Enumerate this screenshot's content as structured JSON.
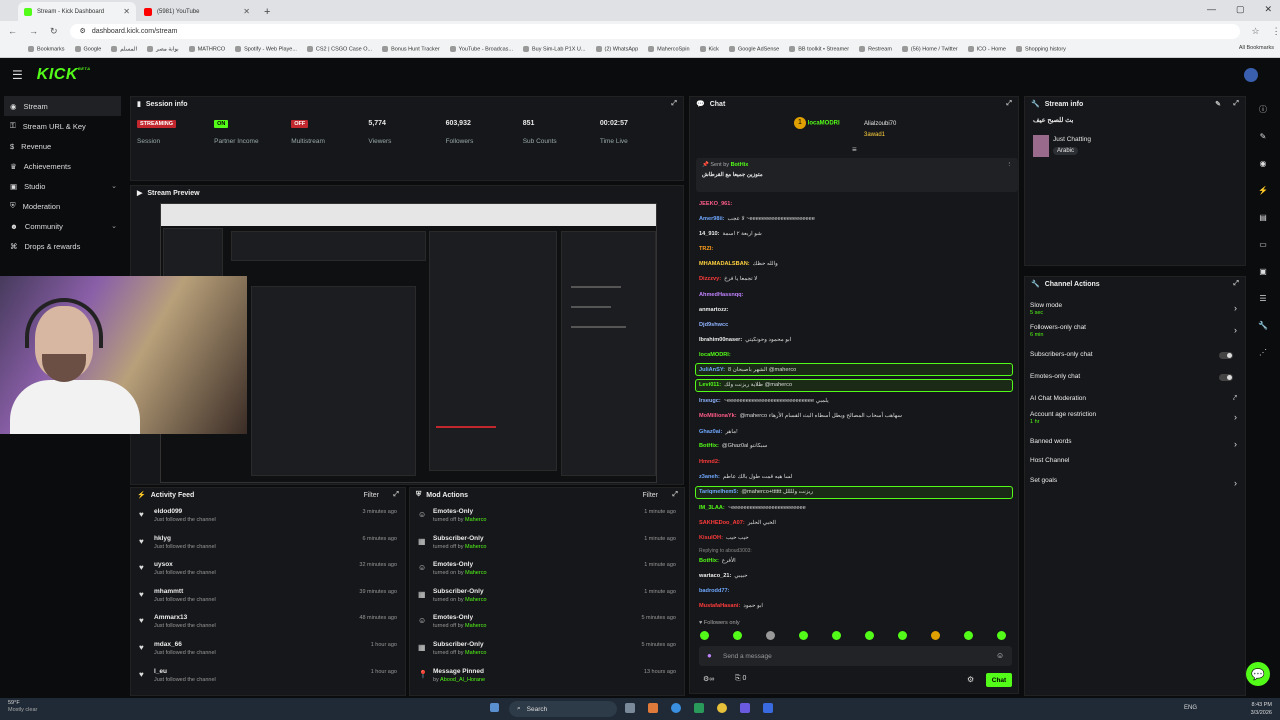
{
  "browser": {
    "tabs": [
      {
        "title": "Stream - Kick Dashboard",
        "fav_color": "#53fc18"
      },
      {
        "title": "(5981) YouTube",
        "fav_color": "#ff0000"
      }
    ],
    "url": "dashboard.kick.com/stream",
    "bookmarks": [
      "Bookmarks",
      "Google",
      "المسلم",
      "بوابة مصر",
      "MATHRCO",
      "Spotify - Web Playe...",
      "CS2 | CSGO Case O...",
      "Bonus Hunt Tracker",
      "YouTube - Broadcas...",
      "Buy Sim-Lab P1X U...",
      "(2) WhatsApp",
      "MahercoSpin",
      "Kick",
      "Google AdSense",
      "BB toolkit • Streamer",
      "Restream",
      "(56) Home / Twitter",
      "ICO - Home",
      "Shopping history"
    ],
    "all_bookmarks": "All Bookmarks"
  },
  "header": {
    "logo": "KICK",
    "beta": "BETA"
  },
  "sidebar": {
    "items": [
      {
        "label": "Stream",
        "icon": "stream-icon"
      },
      {
        "label": "Stream URL & Key",
        "icon": "key-icon"
      },
      {
        "label": "Revenue",
        "icon": "revenue-icon"
      },
      {
        "label": "Achievements",
        "icon": "trophy-icon"
      },
      {
        "label": "Studio",
        "icon": "studio-icon"
      },
      {
        "label": "Moderation",
        "icon": "shield-icon"
      },
      {
        "label": "Community",
        "icon": "community-icon"
      },
      {
        "label": "Drops & rewards",
        "icon": "gift-icon"
      }
    ]
  },
  "session": {
    "title": "Session info",
    "stats": [
      {
        "value": "STREAMING",
        "label": "Session",
        "badge": "red"
      },
      {
        "value": "ON",
        "label": "Partner Income",
        "badge": "green"
      },
      {
        "value": "OFF",
        "label": "Multistream",
        "badge": "red"
      },
      {
        "value": "5,774",
        "label": "Viewers"
      },
      {
        "value": "603,932",
        "label": "Followers"
      },
      {
        "value": "851",
        "label": "Sub Counts"
      },
      {
        "value": "00:02:57",
        "label": "Time Live"
      }
    ]
  },
  "preview": {
    "title": "Stream Preview"
  },
  "activity": {
    "title": "Activity Feed",
    "filter": "Filter",
    "items": [
      {
        "name": "eldod099",
        "sub": "Just followed the channel",
        "time": "3 minutes ago"
      },
      {
        "name": "hklyg",
        "sub": "Just followed the channel",
        "time": "6 minutes ago"
      },
      {
        "name": "uysox",
        "sub": "Just followed the channel",
        "time": "32 minutes ago"
      },
      {
        "name": "mhammtt",
        "sub": "Just followed the channel",
        "time": "39 minutes ago"
      },
      {
        "name": "Ammarx13",
        "sub": "Just followed the channel",
        "time": "48 minutes ago"
      },
      {
        "name": "mdax_66",
        "sub": "Just followed the channel",
        "time": "1 hour ago"
      },
      {
        "name": "l_eu",
        "sub": "Just followed the channel",
        "time": "1 hour ago"
      }
    ]
  },
  "mod": {
    "title": "Mod Actions",
    "filter": "Filter",
    "items": [
      {
        "name": "Emotes-Only",
        "pre": "turned off by",
        "by": "Maherco",
        "time": "1 minute ago",
        "icon": "smile-icon"
      },
      {
        "name": "Subscriber-Only",
        "pre": "turned off by",
        "by": "Maherco",
        "time": "1 minute ago",
        "icon": "gift-icon"
      },
      {
        "name": "Emotes-Only",
        "pre": "turned on by",
        "by": "Maherco",
        "time": "1 minute ago",
        "icon": "smile-icon"
      },
      {
        "name": "Subscriber-Only",
        "pre": "turned on by",
        "by": "Maherco",
        "time": "1 minute ago",
        "icon": "gift-icon"
      },
      {
        "name": "Emotes-Only",
        "pre": "turned off by",
        "by": "Maherco",
        "time": "5 minutes ago",
        "icon": "smile-icon"
      },
      {
        "name": "Subscriber-Only",
        "pre": "turned off by",
        "by": "Maherco",
        "time": "5 minutes ago",
        "icon": "gift-icon"
      },
      {
        "name": "Message Pinned",
        "pre": "by",
        "by": "Abood_Al_Horane",
        "time": "13 hours ago",
        "icon": "pin-icon"
      }
    ]
  },
  "chat": {
    "title": "Chat",
    "top": [
      {
        "name": "locaMODRI",
        "val": "1"
      },
      {
        "name": "Alialzoubi70",
        "val": "1"
      },
      {
        "name": "3awad1",
        "val": "1"
      }
    ],
    "pinned_by": "Sent by",
    "pinned_user": "BotHix",
    "pinned_text": "متوزين جميعا مع القرطاش",
    "messages": [
      {
        "u": "JEEKO_961:",
        "t": "",
        "c": "#ff5c8a"
      },
      {
        "u": "Amer98ii:",
        "t": "لا عجب ~eeeeeeeeeeeeeeeeeeeee",
        "c": "#6fa8ff"
      },
      {
        "u": "14_910:",
        "t": "شو اربعة ٢ اسمة",
        "c": "#eeeeee"
      },
      {
        "u": "TRZI:",
        "t": "",
        "c": "#ff9f1a"
      },
      {
        "u": "MHAMADALSBAN:",
        "t": "والله حظك",
        "c": "#ffd23f"
      },
      {
        "u": "Dizzzvy:",
        "t": "لا تجمعا يا فرخ",
        "c": "#ff3b3b"
      },
      {
        "u": "AhmedHassnqq:",
        "t": "",
        "c": "#c183ff"
      },
      {
        "u": "anmartozz:",
        "t": "",
        "c": "#eeeeee"
      },
      {
        "u": "Djd9shwcc",
        "t": "",
        "c": "#8fb3ff"
      },
      {
        "u": "Ibrahim00naser:",
        "t": "ابو محمود وحونكيتي",
        "c": "#eeeeee"
      },
      {
        "u": "locaMODRI:",
        "t": "",
        "c": "#53fc18"
      },
      {
        "u": "JuliAnSY:",
        "t": "الشهر باصبحان 8 @maherco",
        "c": "#6fa8ff"
      },
      {
        "u": "Levi011:",
        "t": "ظلاية ريزنت ولك @maherco",
        "c": "#53fc18"
      },
      {
        "u": "Irseugc:",
        "t": "~eeeeeeeeeeeeeeeeeeeeeeeeeeee يلمبي",
        "c": "#8fb3ff"
      },
      {
        "u": "MoMillionaYk:",
        "t": "@maherco سهاهب أسحاب المصالح ويطل أسطاه البث القسام الأرهاء",
        "c": "#ff5c8a"
      },
      {
        "u": "Ghaz0ai:",
        "t": "ماهر!",
        "c": "#6fa8ff"
      },
      {
        "u": "BotHix:",
        "t": "@Ghaz0al سبكانتو",
        "c": "#53fc18"
      },
      {
        "u": "Hmnd2:",
        "t": "",
        "c": "#ff3b3b"
      },
      {
        "u": "z3aneh:",
        "t": "لسا هيه قمت طول بالك عاطم",
        "c": "#6fa8ff"
      },
      {
        "u": "Tariqmelhem5:",
        "t": "@maherco+tttttt ريزنت وللللل",
        "c": "#6fa8ff"
      },
      {
        "u": "IM_3LAA:",
        "t": "~eeeeeeeeeeeeeeeeeeeeeeee",
        "c": "#53fc18"
      },
      {
        "u": "SAKHEDoo_A07:",
        "t": "الخبي الحلبر",
        "c": "#ff3b3b"
      },
      {
        "u": "KisulOH:",
        "t": "حيب حيب",
        "c": "#ff3b3b"
      },
      {
        "u": "BotHix:",
        "t": "الأفرع",
        "c": "#53fc18"
      },
      {
        "u": "wartaco_21:",
        "t": "حبيبي",
        "c": "#eeeeee"
      },
      {
        "u": "badrodd77:",
        "t": "",
        "c": "#6fa8ff"
      },
      {
        "u": "MustafaHasani:",
        "t": "ابو حمود",
        "c": "#ff3b3b"
      }
    ],
    "reply": "Replying to aboud3003:",
    "followers_only": "Followers only",
    "placeholder": "Send a message",
    "chat_button": "Chat",
    "points": "0"
  },
  "stream_info": {
    "title": "Stream info",
    "stream_title": "بث للصبح عيف",
    "category": "Just Chatting",
    "tag": "Arabic"
  },
  "channel_actions": {
    "title": "Channel Actions",
    "items": [
      {
        "label": "Slow mode",
        "sub": "5 sec",
        "kind": "arrow"
      },
      {
        "label": "Followers-only chat",
        "sub": "6 min",
        "kind": "arrow"
      },
      {
        "label": "Subscribers-only chat",
        "sub": "",
        "kind": "toggle"
      },
      {
        "label": "Emotes-only chat",
        "sub": "",
        "kind": "toggle"
      },
      {
        "label": "AI Chat Moderation",
        "sub": "",
        "kind": "ext"
      },
      {
        "label": "Account age restriction",
        "sub": "1 hr",
        "kind": "arrow"
      },
      {
        "label": "Banned words",
        "sub": "",
        "kind": "arrow"
      },
      {
        "label": "Host Channel",
        "sub": "",
        "kind": "none"
      },
      {
        "label": "Set goals",
        "sub": "",
        "kind": "arrow"
      }
    ]
  },
  "taskbar": {
    "temp": "59°F",
    "weather": "Mostly clear",
    "search": "Search",
    "lang": "ENG",
    "time": "8:43 PM",
    "date": "3/3/2026"
  },
  "colors": {
    "accent": "#53fc18",
    "danger": "#c1272d",
    "panel": "#16171a"
  }
}
